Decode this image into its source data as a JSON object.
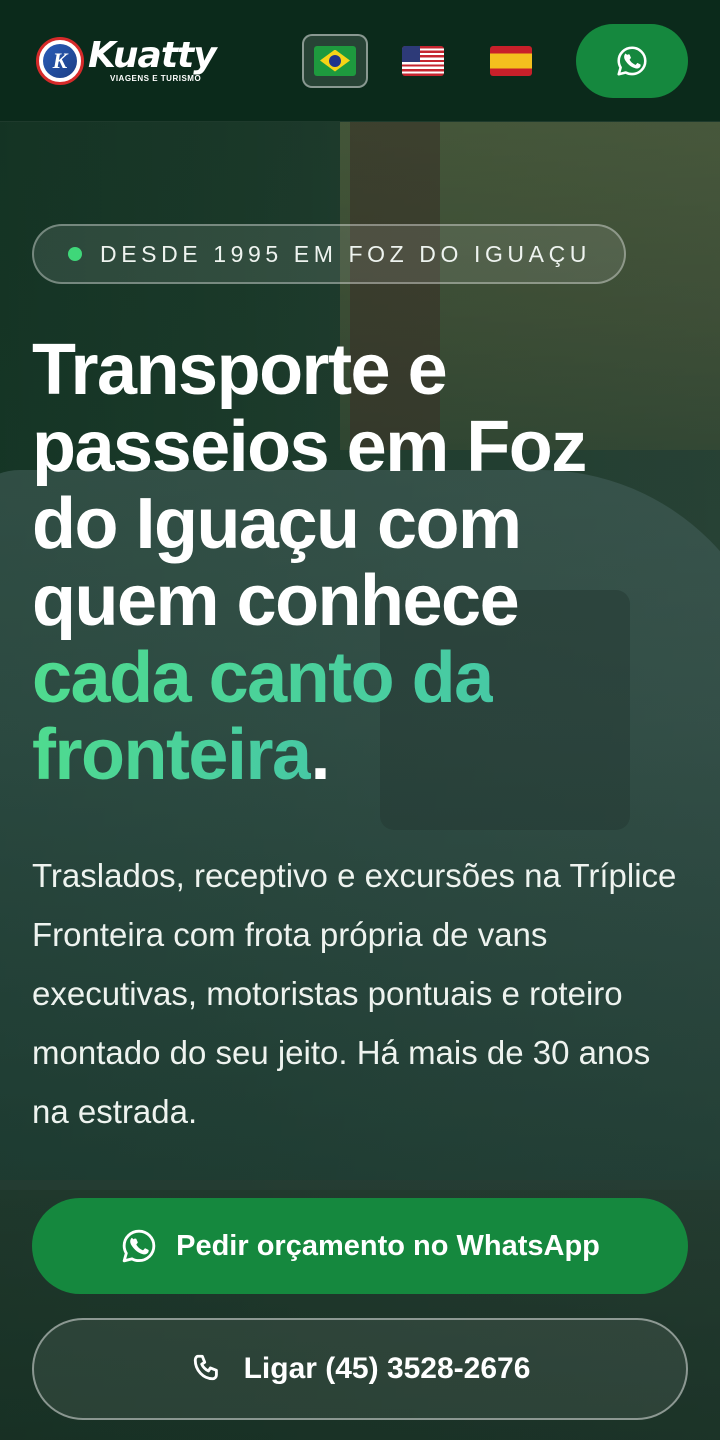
{
  "header": {
    "logo": {
      "name": "Kuatty",
      "subtitle": "VIAGENS E TURISMO",
      "mark_letter": "K"
    },
    "languages": [
      {
        "code": "pt-BR",
        "icon": "brazil-flag-icon",
        "active": true
      },
      {
        "code": "en-US",
        "icon": "usa-flag-icon",
        "active": false
      },
      {
        "code": "es",
        "icon": "spain-flag-icon",
        "active": false
      }
    ],
    "whatsapp_icon": "whatsapp-icon"
  },
  "hero": {
    "badge": "DESDE 1995 EM FOZ DO IGUAÇU",
    "headline_line1": "Transporte e",
    "headline_line2": "passeios em Foz",
    "headline_line3": "do Iguaçu com",
    "headline_line4": "quem conhece",
    "headline_accent_line1": "cada canto da",
    "headline_accent_line2": "fronteira",
    "headline_period": ".",
    "lede": "Traslados, receptivo e excursões na Tríplice Fronteira com frota própria de vans executivas, motoristas pontuais e roteiro montado do seu jeito. Há mais de 30 anos na estrada."
  },
  "actions": {
    "whatsapp_label": "Pedir orçamento no WhatsApp",
    "call_label": "Ligar (45) 3528-2676"
  },
  "colors": {
    "primary_green": "#15883e",
    "accent_green": "#4fdb8f",
    "header_bg": "#0b2a1b",
    "badge_dot": "#3fd779"
  }
}
